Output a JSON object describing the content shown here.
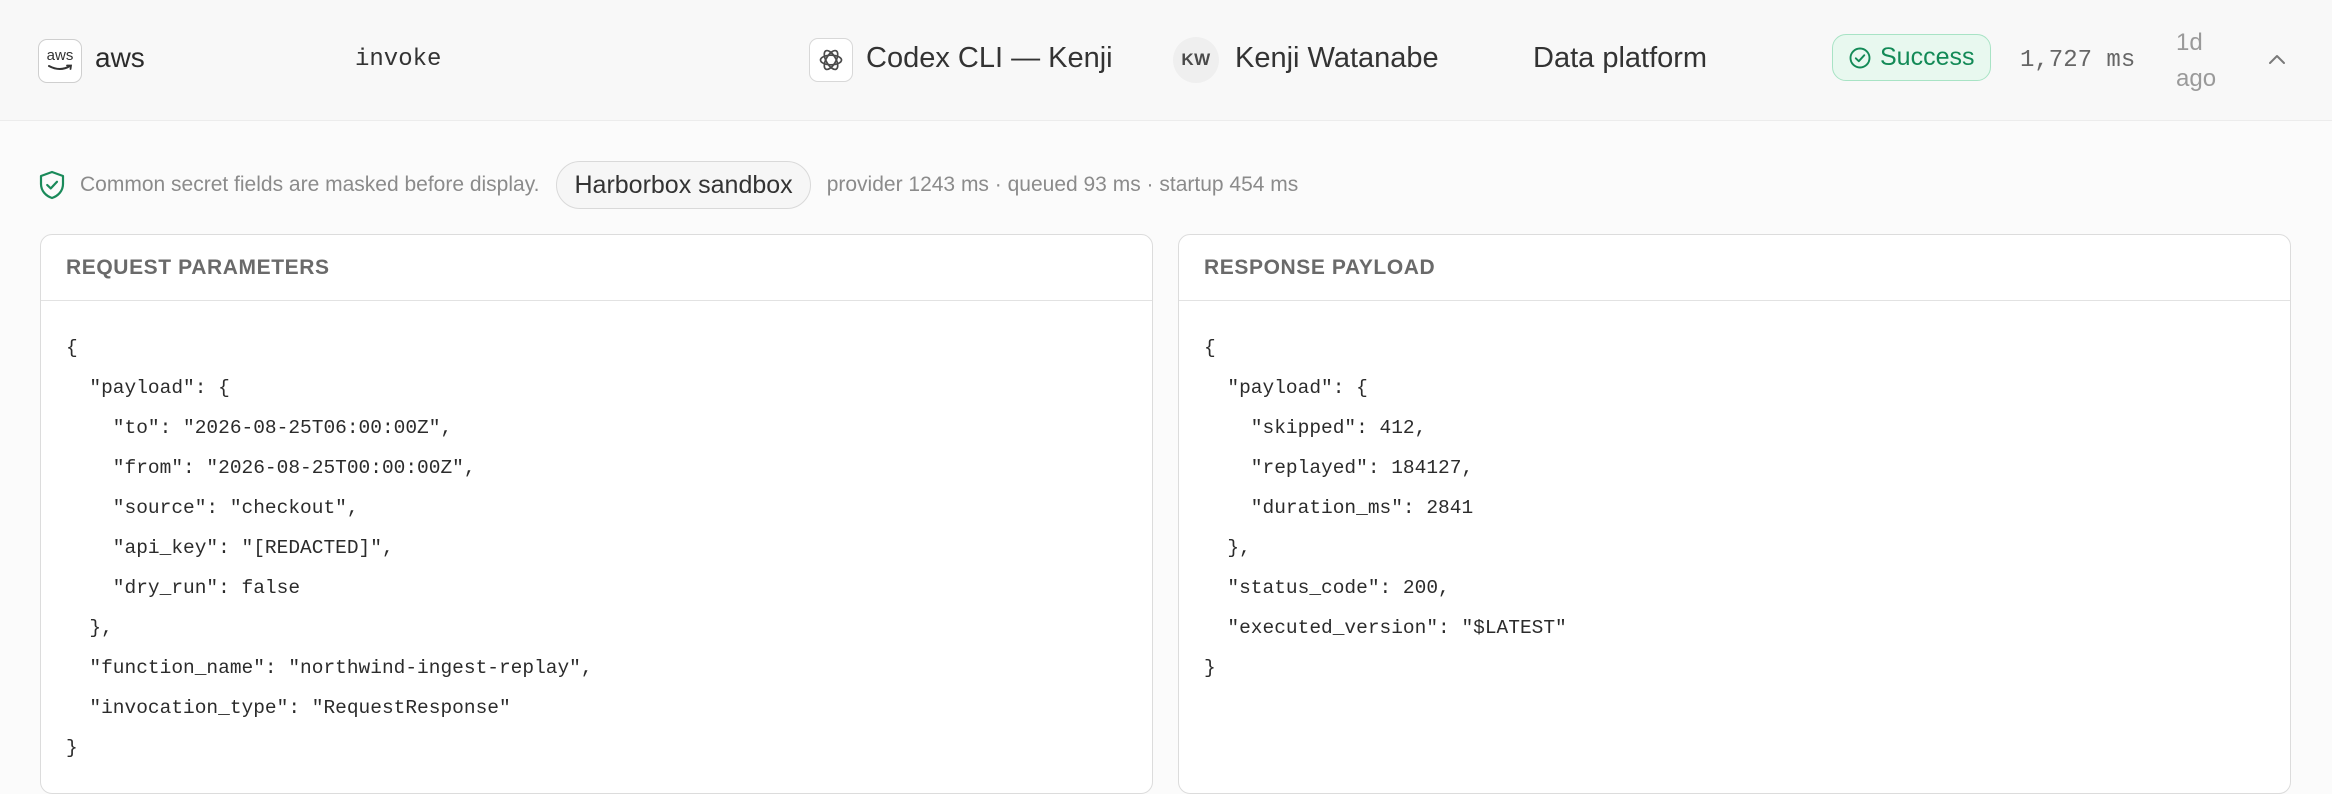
{
  "header": {
    "provider_logo_text": "aws",
    "provider": "aws",
    "method": "invoke",
    "client": "Codex CLI — Kenji",
    "user_initials": "KW",
    "user": "Kenji Watanabe",
    "team": "Data platform",
    "status": "Success",
    "duration": "1,727 ms",
    "time_ago": "1d ago"
  },
  "notice": {
    "masking_text": "Common secret fields are masked before display.",
    "environment": "Harborbox sandbox",
    "timings": "provider 1243 ms · queued 93 ms · startup 454 ms"
  },
  "request": {
    "title": "REQUEST PARAMETERS",
    "lines": [
      "{",
      "  \"payload\": {",
      "    \"to\": \"2026-08-25T06:00:00Z\",",
      "    \"from\": \"2026-08-25T00:00:00Z\",",
      "    \"source\": \"checkout\",",
      "    \"api_key\": \"[REDACTED]\",",
      "    \"dry_run\": false",
      "  },",
      "  \"function_name\": \"northwind-ingest-replay\",",
      "  \"invocation_type\": \"RequestResponse\"",
      "}"
    ]
  },
  "response": {
    "title": "RESPONSE PAYLOAD",
    "lines": [
      "{",
      "  \"payload\": {",
      "    \"skipped\": 412,",
      "    \"replayed\": 184127,",
      "    \"duration_ms\": 2841",
      "  },",
      "  \"status_code\": 200,",
      "  \"executed_version\": \"$LATEST\"",
      "}"
    ]
  },
  "colors": {
    "success_text": "#138a57",
    "success_bg": "#e8f8ef",
    "success_border": "#a8e3c5",
    "shield": "#1a8a5a"
  },
  "icons": {
    "provider": "aws-logo-icon",
    "client": "openai-icon",
    "status": "check-circle-icon",
    "collapse": "chevron-up-icon",
    "notice": "shield-check-icon"
  }
}
